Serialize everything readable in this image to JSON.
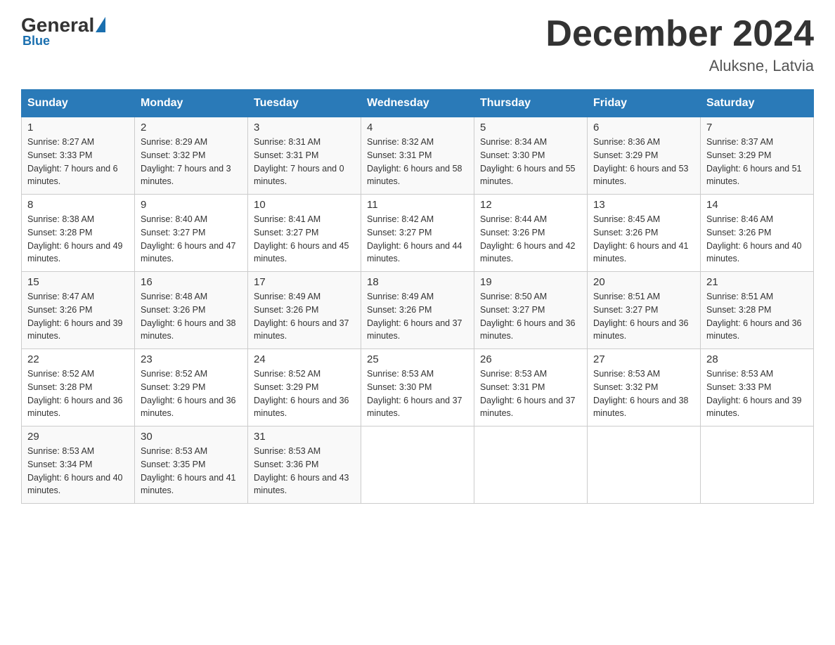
{
  "header": {
    "logo_general": "General",
    "logo_blue": "Blue",
    "month_year": "December 2024",
    "location": "Aluksne, Latvia"
  },
  "days_of_week": [
    "Sunday",
    "Monday",
    "Tuesday",
    "Wednesday",
    "Thursday",
    "Friday",
    "Saturday"
  ],
  "weeks": [
    [
      {
        "day": "1",
        "sunrise": "8:27 AM",
        "sunset": "3:33 PM",
        "daylight": "7 hours and 6 minutes."
      },
      {
        "day": "2",
        "sunrise": "8:29 AM",
        "sunset": "3:32 PM",
        "daylight": "7 hours and 3 minutes."
      },
      {
        "day": "3",
        "sunrise": "8:31 AM",
        "sunset": "3:31 PM",
        "daylight": "7 hours and 0 minutes."
      },
      {
        "day": "4",
        "sunrise": "8:32 AM",
        "sunset": "3:31 PM",
        "daylight": "6 hours and 58 minutes."
      },
      {
        "day": "5",
        "sunrise": "8:34 AM",
        "sunset": "3:30 PM",
        "daylight": "6 hours and 55 minutes."
      },
      {
        "day": "6",
        "sunrise": "8:36 AM",
        "sunset": "3:29 PM",
        "daylight": "6 hours and 53 minutes."
      },
      {
        "day": "7",
        "sunrise": "8:37 AM",
        "sunset": "3:29 PM",
        "daylight": "6 hours and 51 minutes."
      }
    ],
    [
      {
        "day": "8",
        "sunrise": "8:38 AM",
        "sunset": "3:28 PM",
        "daylight": "6 hours and 49 minutes."
      },
      {
        "day": "9",
        "sunrise": "8:40 AM",
        "sunset": "3:27 PM",
        "daylight": "6 hours and 47 minutes."
      },
      {
        "day": "10",
        "sunrise": "8:41 AM",
        "sunset": "3:27 PM",
        "daylight": "6 hours and 45 minutes."
      },
      {
        "day": "11",
        "sunrise": "8:42 AM",
        "sunset": "3:27 PM",
        "daylight": "6 hours and 44 minutes."
      },
      {
        "day": "12",
        "sunrise": "8:44 AM",
        "sunset": "3:26 PM",
        "daylight": "6 hours and 42 minutes."
      },
      {
        "day": "13",
        "sunrise": "8:45 AM",
        "sunset": "3:26 PM",
        "daylight": "6 hours and 41 minutes."
      },
      {
        "day": "14",
        "sunrise": "8:46 AM",
        "sunset": "3:26 PM",
        "daylight": "6 hours and 40 minutes."
      }
    ],
    [
      {
        "day": "15",
        "sunrise": "8:47 AM",
        "sunset": "3:26 PM",
        "daylight": "6 hours and 39 minutes."
      },
      {
        "day": "16",
        "sunrise": "8:48 AM",
        "sunset": "3:26 PM",
        "daylight": "6 hours and 38 minutes."
      },
      {
        "day": "17",
        "sunrise": "8:49 AM",
        "sunset": "3:26 PM",
        "daylight": "6 hours and 37 minutes."
      },
      {
        "day": "18",
        "sunrise": "8:49 AM",
        "sunset": "3:26 PM",
        "daylight": "6 hours and 37 minutes."
      },
      {
        "day": "19",
        "sunrise": "8:50 AM",
        "sunset": "3:27 PM",
        "daylight": "6 hours and 36 minutes."
      },
      {
        "day": "20",
        "sunrise": "8:51 AM",
        "sunset": "3:27 PM",
        "daylight": "6 hours and 36 minutes."
      },
      {
        "day": "21",
        "sunrise": "8:51 AM",
        "sunset": "3:28 PM",
        "daylight": "6 hours and 36 minutes."
      }
    ],
    [
      {
        "day": "22",
        "sunrise": "8:52 AM",
        "sunset": "3:28 PM",
        "daylight": "6 hours and 36 minutes."
      },
      {
        "day": "23",
        "sunrise": "8:52 AM",
        "sunset": "3:29 PM",
        "daylight": "6 hours and 36 minutes."
      },
      {
        "day": "24",
        "sunrise": "8:52 AM",
        "sunset": "3:29 PM",
        "daylight": "6 hours and 36 minutes."
      },
      {
        "day": "25",
        "sunrise": "8:53 AM",
        "sunset": "3:30 PM",
        "daylight": "6 hours and 37 minutes."
      },
      {
        "day": "26",
        "sunrise": "8:53 AM",
        "sunset": "3:31 PM",
        "daylight": "6 hours and 37 minutes."
      },
      {
        "day": "27",
        "sunrise": "8:53 AM",
        "sunset": "3:32 PM",
        "daylight": "6 hours and 38 minutes."
      },
      {
        "day": "28",
        "sunrise": "8:53 AM",
        "sunset": "3:33 PM",
        "daylight": "6 hours and 39 minutes."
      }
    ],
    [
      {
        "day": "29",
        "sunrise": "8:53 AM",
        "sunset": "3:34 PM",
        "daylight": "6 hours and 40 minutes."
      },
      {
        "day": "30",
        "sunrise": "8:53 AM",
        "sunset": "3:35 PM",
        "daylight": "6 hours and 41 minutes."
      },
      {
        "day": "31",
        "sunrise": "8:53 AM",
        "sunset": "3:36 PM",
        "daylight": "6 hours and 43 minutes."
      },
      null,
      null,
      null,
      null
    ]
  ]
}
